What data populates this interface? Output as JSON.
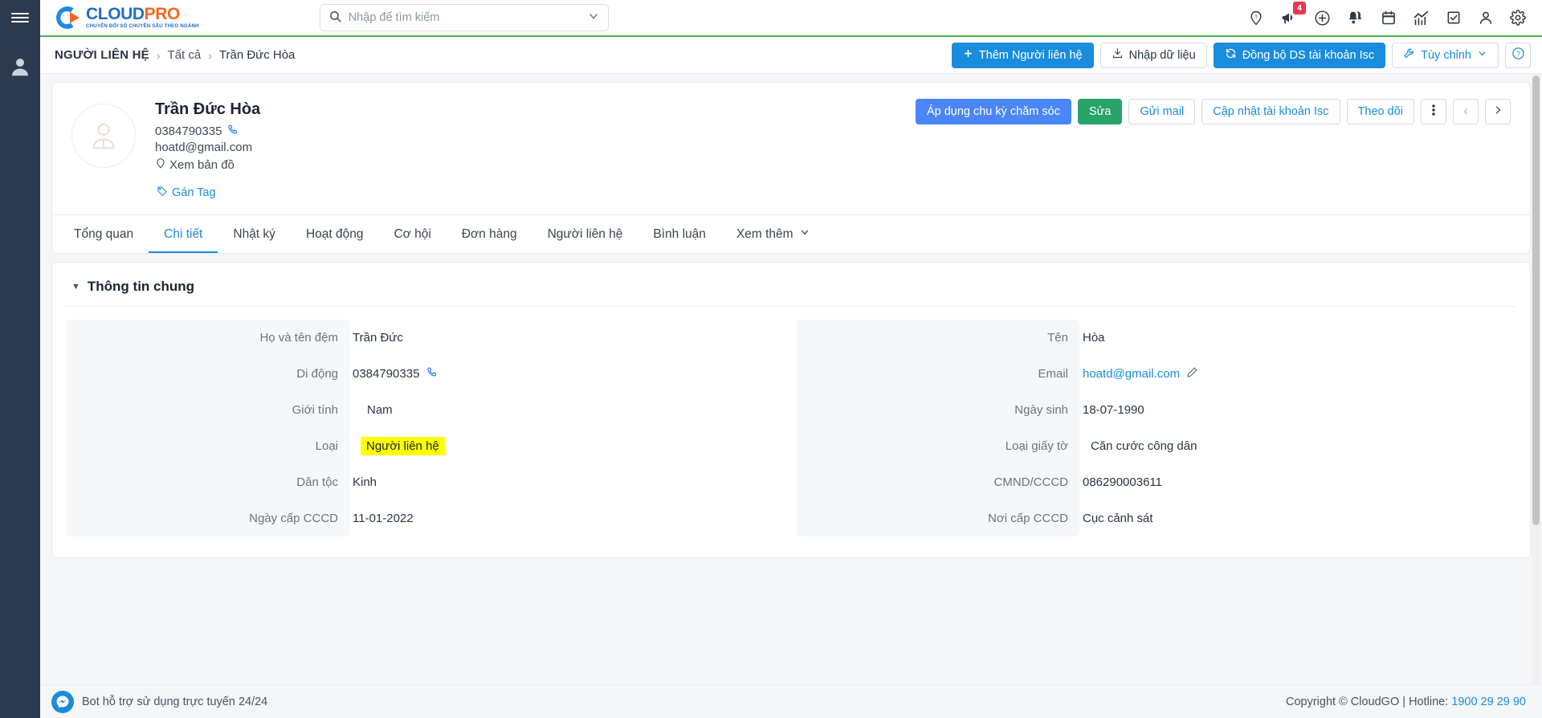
{
  "sidebar": {
    "menu_icon": "hamburger-icon",
    "avatar_icon": "user-avatar-icon"
  },
  "header": {
    "logo_main_1": "CLOUD",
    "logo_main_2": "PRO",
    "logo_sub": "CHUYỂN ĐỔI SỐ CHUYÊN SÂU THEO NGÀNH",
    "search": {
      "placeholder": "Nhập để tìm kiếm",
      "value": ""
    },
    "icons": [
      {
        "name": "location-help-icon",
        "badge": ""
      },
      {
        "name": "megaphone-icon",
        "badge": "4"
      },
      {
        "name": "plus-circle-icon",
        "badge": ""
      },
      {
        "name": "bells-icon",
        "badge": ""
      },
      {
        "name": "calendar-icon",
        "badge": ""
      },
      {
        "name": "chart-icon",
        "badge": ""
      },
      {
        "name": "checkbox-icon",
        "badge": ""
      },
      {
        "name": "person-icon",
        "badge": ""
      },
      {
        "name": "gear-icon",
        "badge": ""
      }
    ],
    "badge_color": "#e8384f"
  },
  "breadcrumb": {
    "root": "NGƯỜI LIÊN HỆ",
    "separator": "›",
    "items": [
      "Tất cả",
      "Trần Đức Hòa"
    ]
  },
  "page_actions": {
    "add_contact": "Thêm Người liên hệ",
    "import_data": "Nhập dữ liệu",
    "sync_account": "Đồng bộ DS tài khoản Isc",
    "customize": "Tùy chỉnh",
    "help": "?"
  },
  "contact": {
    "name": "Trần Đức Hòa",
    "phone": "0384790335",
    "email": "hoatd@gmail.com",
    "map_link": "Xem bản đồ",
    "tag_link": "Gán Tag",
    "actions": {
      "apply_care_cycle": "Áp dụng chu kỳ chăm sóc",
      "edit": "Sửa",
      "send_mail": "Gửi mail",
      "update_account": "Cập nhật tài khoản Isc",
      "follow": "Theo dõi",
      "more": "⋮",
      "prev": "‹",
      "next": "›"
    },
    "colors": {
      "apply": "#4a86f7",
      "edit": "#28a36a",
      "link": "#1a8cdd"
    }
  },
  "tabs": [
    {
      "label": "Tổng quan",
      "active": false
    },
    {
      "label": "Chi tiết",
      "active": true
    },
    {
      "label": "Nhật ký",
      "active": false
    },
    {
      "label": "Hoạt động",
      "active": false
    },
    {
      "label": "Cơ hội",
      "active": false
    },
    {
      "label": "Đơn hàng",
      "active": false
    },
    {
      "label": "Người liên hệ",
      "active": false
    },
    {
      "label": "Bình luận",
      "active": false
    },
    {
      "label": "Xem thêm",
      "active": false
    }
  ],
  "detail": {
    "section_title": "Thông tin chung",
    "left_fields": [
      {
        "label": "Họ và tên đệm",
        "value": "Trần Đức"
      },
      {
        "label": "Di động",
        "value": "0384790335"
      },
      {
        "label": "Giới tính",
        "value": "Nam"
      },
      {
        "label": "Loại",
        "value": "Người liên hệ"
      },
      {
        "label": "Dân tộc",
        "value": "Kinh"
      },
      {
        "label": "Ngày cấp CCCD",
        "value": "11-01-2022"
      }
    ],
    "right_fields": [
      {
        "label": "Tên",
        "value": "Hòa"
      },
      {
        "label": "Email",
        "value": "hoatd@gmail.com"
      },
      {
        "label": "Ngày sinh",
        "value": "18-07-1990"
      },
      {
        "label": "Loại giấy tờ",
        "value": "Căn cước công dân"
      },
      {
        "label": "CMND/CCCD",
        "value": "086290003611"
      },
      {
        "label": "Nơi cấp CCCD",
        "value": "Cục cảnh sát"
      }
    ],
    "highlight_color": "#ffff00"
  },
  "footer": {
    "bot_text": "Bot hỗ trợ sử dụng trực tuyến 24/24",
    "copyright": "Copyright © CloudGO | Hotline: ",
    "hotline": "1900 29 29 90"
  }
}
